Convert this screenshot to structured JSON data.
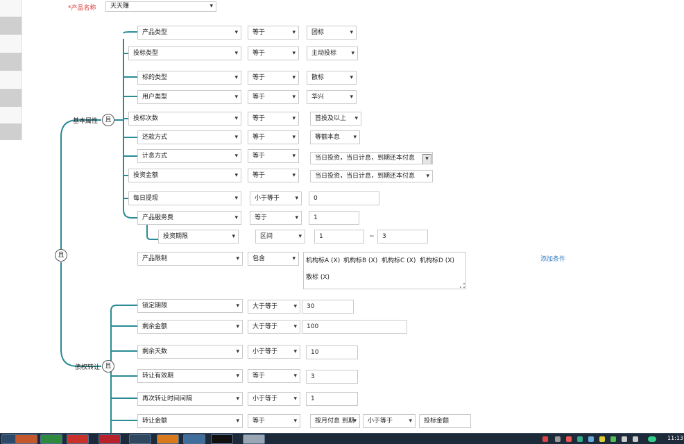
{
  "product": {
    "label": "*产品名称",
    "value": "天天赚"
  },
  "groups": {
    "basic": "基本属性",
    "transfer": "债权转让",
    "root_op": "且",
    "basic_op": "且",
    "transfer_op": "且"
  },
  "rows": [
    {
      "field": "产品类型",
      "op": "等于",
      "value": "团标"
    },
    {
      "field": "投标类型",
      "op": "等于",
      "value": "主动投标"
    },
    {
      "field": "标的类型",
      "op": "等于",
      "value": "散标"
    },
    {
      "field": "用户类型",
      "op": "等于",
      "value": "华兴"
    },
    {
      "field": "投标次数",
      "op": "等于",
      "value": "首投及以上"
    },
    {
      "field": "还款方式",
      "op": "等于",
      "value": "等额本息"
    },
    {
      "field": "计息方式",
      "op": "等于",
      "value": "当日投资，当日计息，到期还本付息"
    },
    {
      "field": "投资金额",
      "op": "等于",
      "value": "当日投资，当日计息，到期还本付息"
    },
    {
      "field": "每日提现",
      "op": "小于等于",
      "value": "0"
    },
    {
      "field": "产品服务费",
      "op": "等于",
      "value": "1"
    }
  ],
  "sub_row": {
    "field": "投资期限",
    "op": "区间",
    "from": "1",
    "sep": "~",
    "to": "3"
  },
  "limit": {
    "field": "产品限制",
    "op": "包含",
    "tags": [
      "机构标A (X)",
      "机构标B (X)",
      "机构标C (X)",
      "机构标D (X)",
      "散标 (X)"
    ],
    "add_link": "添加条件"
  },
  "transfer_rows": [
    {
      "field": "锁定期限",
      "op": "大于等于",
      "value": "30"
    },
    {
      "field": "剩余金额",
      "op": "大于等于",
      "value": "100"
    },
    {
      "field": "剩余天数",
      "op": "小于等于",
      "value": "10"
    },
    {
      "field": "转让有效期",
      "op": "等于",
      "value": "3"
    },
    {
      "field": "再次转让时间间隔",
      "op": "小于等于",
      "value": "1"
    },
    {
      "field": "转让金额",
      "op": "等于",
      "value": "按月付息 到期",
      "op2": "小于等于",
      "value2": "投标金额"
    }
  ],
  "taskbar": {
    "clock": "11:13",
    "apps": [
      "firefox-icon",
      "chrome-icon",
      "youdao-icon",
      "netease-music-icon",
      "ide-icon",
      "sublime-icon",
      "app-icon",
      "terminal-icon",
      "app-icon"
    ],
    "colors": {
      "bar": "#1c2a3a"
    }
  }
}
